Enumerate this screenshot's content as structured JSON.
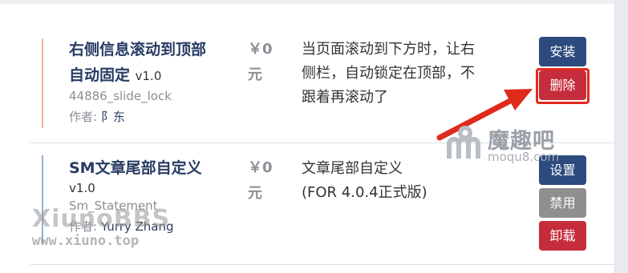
{
  "plugins": [
    {
      "title_line1": "右侧信息滚动到顶部",
      "title_line2": "自动固定",
      "version": "v1.0",
      "slug": "44886_slide_lock",
      "author_label": "作者:",
      "author_name": "阝东",
      "price_line1": "￥0",
      "price_line2": "元",
      "desc_lines": [
        "当页面滚动到下方时，让右",
        "侧栏，自动锁定在顶部，不",
        "跟着再滚动了"
      ],
      "buttons": [
        "安装",
        "删除"
      ],
      "accent_color": "#f3b59a"
    },
    {
      "title_line1": "SM文章尾部自定义",
      "version": "v1.0",
      "slug": "Sm_Statement",
      "author_label": "作者:",
      "author_name": "Yurry Zhang",
      "price_line1": "￥0",
      "price_line2": "元",
      "desc_lines": [
        "文章尾部自定义",
        "(FOR 4.0.4正式版)"
      ],
      "buttons": [
        "设置",
        "禁用",
        "卸载"
      ],
      "accent_color": "#8fb0d6"
    }
  ],
  "watermarks": {
    "brand_cn": "魔趣吧",
    "brand_en": "moqu8.com",
    "xiuno": "XiunoBBS",
    "xiuno_url": "www.xiuno.top"
  },
  "colors": {
    "primary": "#2c4a7e",
    "danger": "#c62d3c",
    "disabled": "#8f8f8f",
    "annotation": "#e02a1c"
  }
}
